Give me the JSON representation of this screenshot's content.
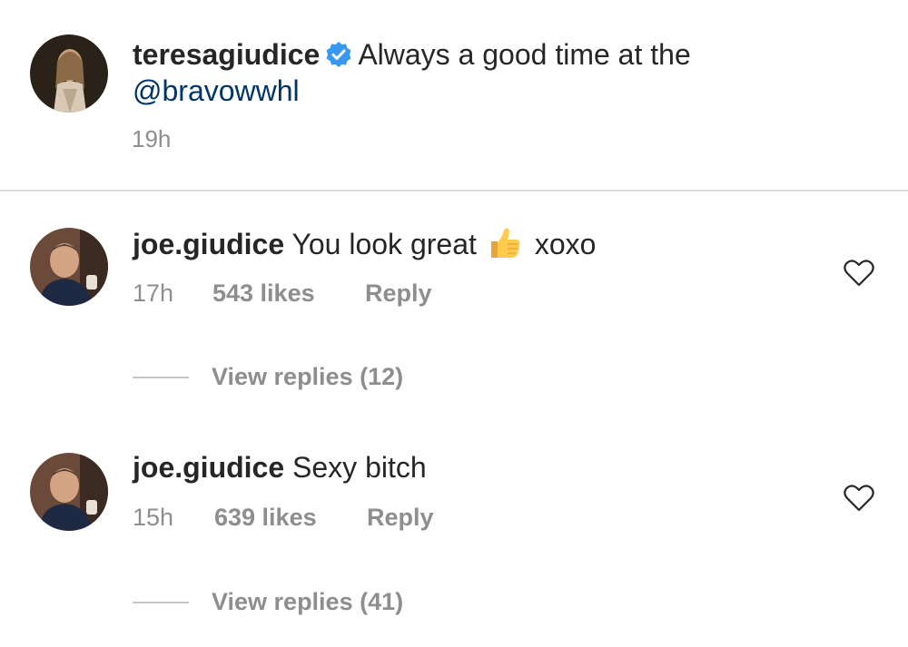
{
  "post": {
    "username": "teresagiudice",
    "caption": "Always a good time at the",
    "mention": "@bravowwhl",
    "time": "19h",
    "verified_color": "#3897f0"
  },
  "comments": [
    {
      "username": "joe.giudice",
      "text": "You look great",
      "emoji": "thumbs-up",
      "text_after": "xoxo",
      "time": "17h",
      "likes": "543 likes",
      "reply": "Reply",
      "view_replies": "View replies (12)"
    },
    {
      "username": "joe.giudice",
      "text": "Sexy bitch",
      "time": "15h",
      "likes": "639 likes",
      "reply": "Reply",
      "view_replies": "View replies (41)"
    }
  ],
  "colors": {
    "text": "#262626",
    "muted": "#8e8e8e",
    "link": "#003569",
    "divider": "#dbdbdb"
  }
}
